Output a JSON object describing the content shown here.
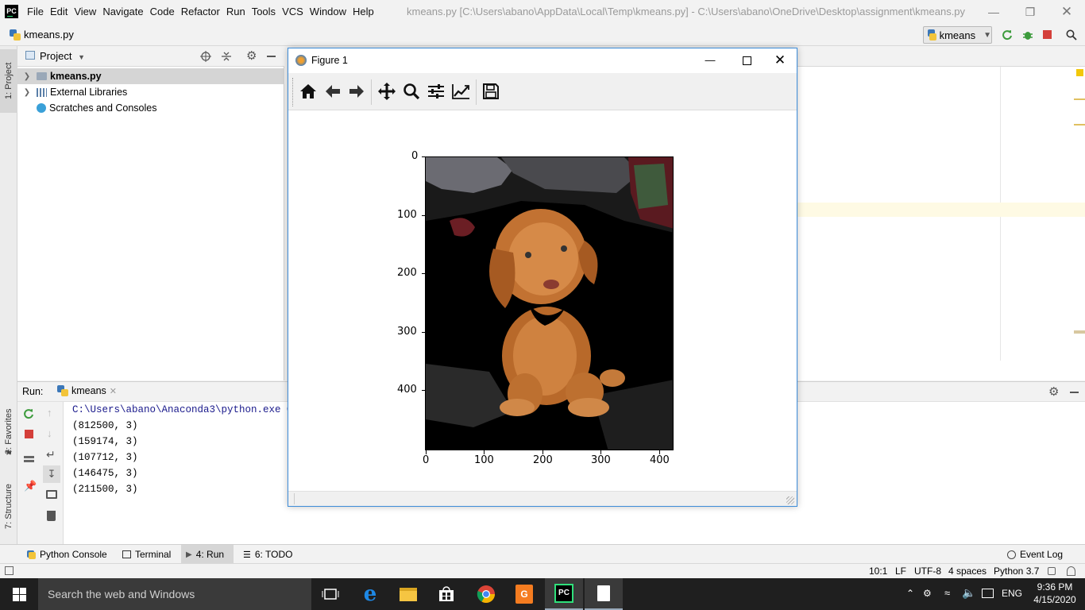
{
  "app": {
    "logo": "PC",
    "menus": [
      "File",
      "Edit",
      "View",
      "Navigate",
      "Code",
      "Refactor",
      "Run",
      "Tools",
      "VCS",
      "Window",
      "Help"
    ],
    "window_title": "kmeans.py [C:\\Users\\abano\\AppData\\Local\\Temp\\kmeans.py] - C:\\Users\\abano\\OneDrive\\Desktop\\assignment\\kmeans.py"
  },
  "navbar": {
    "file": "kmeans.py",
    "run_config": "kmeans"
  },
  "sidebar_tabs": {
    "project": "1: Project",
    "favorites": "2: Favorites",
    "structure": "7: Structure"
  },
  "project": {
    "title": "Project",
    "items": [
      {
        "label": "kmeans.py",
        "icon": "folder-icon"
      },
      {
        "label": "External Libraries",
        "icon": "library-icon"
      },
      {
        "label": "Scratches and Consoles",
        "icon": "scratches-icon"
      }
    ]
  },
  "run": {
    "label": "Run:",
    "tab": "kmeans",
    "console": [
      "C:\\Users\\abano\\Anaconda3\\python.exe C:/",
      "(812500, 3)",
      "(159174, 3)",
      "(107712, 3)",
      "(146475, 3)",
      "(211500, 3)"
    ]
  },
  "tool_tabs": {
    "python_console": "Python Console",
    "terminal": "Terminal",
    "run": "4: Run",
    "todo": "6: TODO",
    "event_log": "Event Log"
  },
  "status": {
    "position": "10:1",
    "line_sep": "LF",
    "encoding": "UTF-8",
    "indent": "4 spaces",
    "interpreter": "Python 3.7"
  },
  "figure": {
    "title": "Figure 1",
    "y_ticks": [
      "0",
      "100",
      "200",
      "300",
      "400"
    ],
    "x_ticks": [
      "0",
      "100",
      "200",
      "300",
      "400"
    ],
    "toolbar": [
      "home-icon",
      "back-icon",
      "forward-icon",
      "pan-icon",
      "zoom-icon",
      "configure-icon",
      "edit-curve-icon",
      "save-icon"
    ]
  },
  "taskbar": {
    "search_placeholder": "Search the web and Windows",
    "language": "ENG",
    "time": "9:36 PM",
    "date": "4/15/2020"
  },
  "colors": {
    "accent": "#3d8cd9",
    "pycharm_green": "#2fe07b",
    "run_green": "#3c9b3c",
    "stop_red": "#d43f3a"
  }
}
